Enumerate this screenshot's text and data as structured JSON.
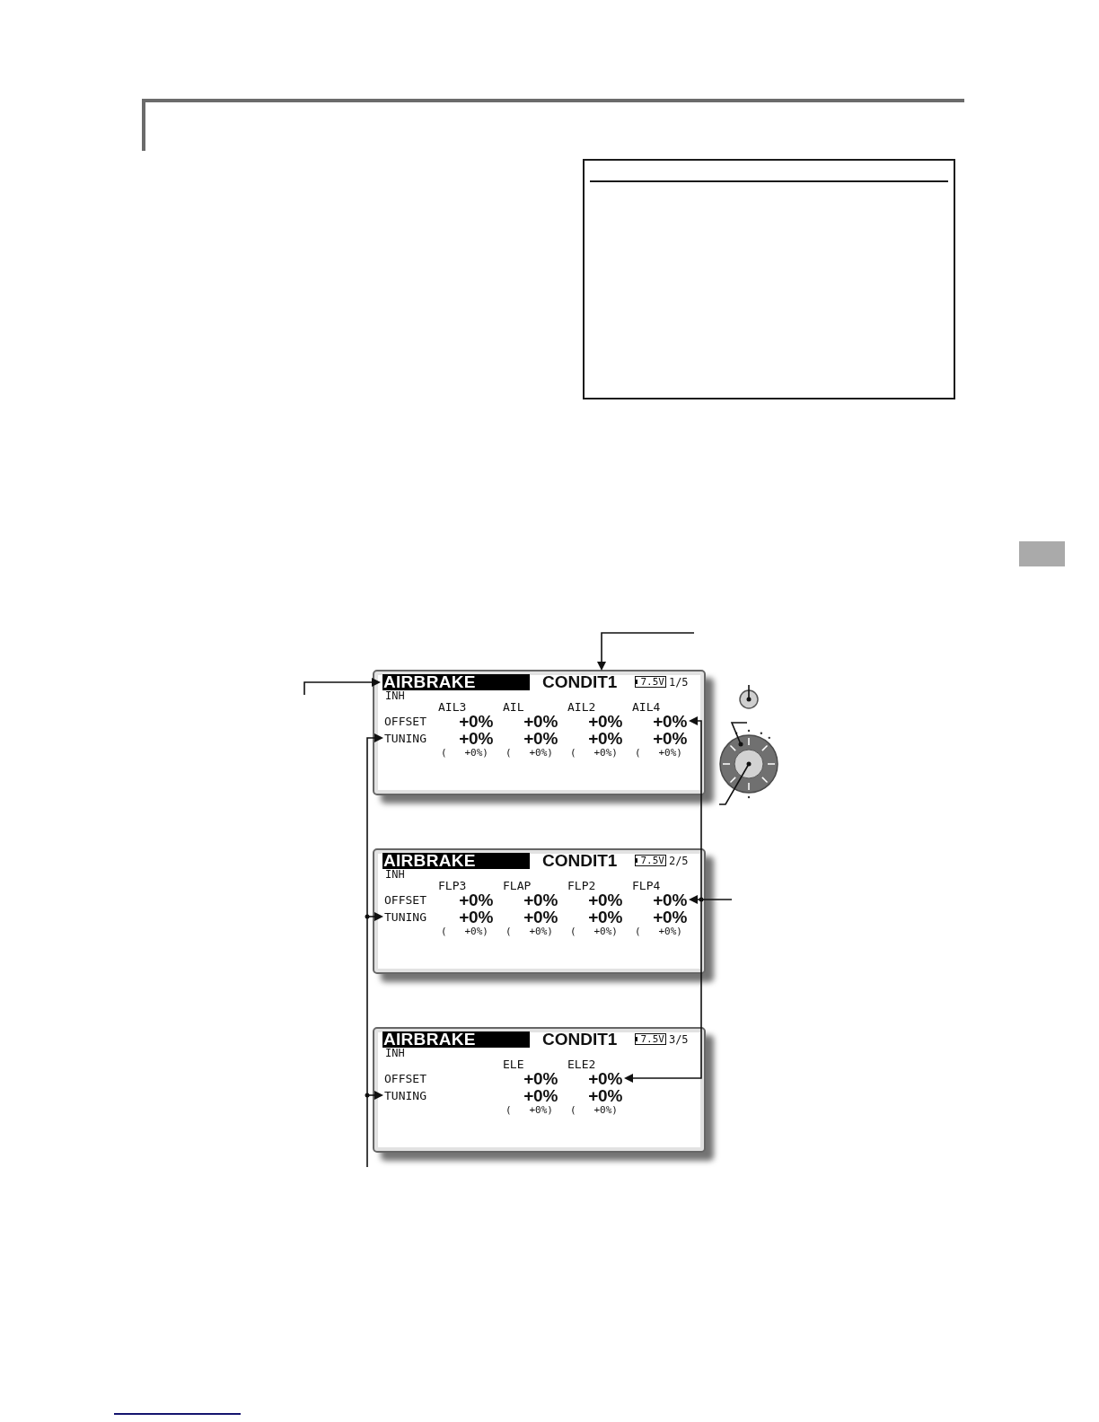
{
  "figure": {
    "screens": [
      {
        "title": "AIRBRAKE",
        "condition": "CONDIT1",
        "battery": "7.5V",
        "page": "1/5",
        "status": "INH",
        "offset_label": "OFFSET",
        "tuning_label": "TUNING",
        "channels": [
          {
            "name": "AIL3",
            "offset": "+0%",
            "tuning": "+0%",
            "rate_open": "(",
            "rate": "+0%)"
          },
          {
            "name": "AIL",
            "offset": "+0%",
            "tuning": "+0%",
            "rate_open": "(",
            "rate": "+0%)"
          },
          {
            "name": "AIL2",
            "offset": "+0%",
            "tuning": "+0%",
            "rate_open": "(",
            "rate": "+0%)"
          },
          {
            "name": "AIL4",
            "offset": "+0%",
            "tuning": "+0%",
            "rate_open": "(",
            "rate": "+0%)"
          }
        ]
      },
      {
        "title": "AIRBRAKE",
        "condition": "CONDIT1",
        "battery": "7.5V",
        "page": "2/5",
        "status": "INH",
        "offset_label": "OFFSET",
        "tuning_label": "TUNING",
        "channels": [
          {
            "name": "FLP3",
            "offset": "+0%",
            "tuning": "+0%",
            "rate_open": "(",
            "rate": "+0%)"
          },
          {
            "name": "FLAP",
            "offset": "+0%",
            "tuning": "+0%",
            "rate_open": "(",
            "rate": "+0%)"
          },
          {
            "name": "FLP2",
            "offset": "+0%",
            "tuning": "+0%",
            "rate_open": "(",
            "rate": "+0%)"
          },
          {
            "name": "FLP4",
            "offset": "+0%",
            "tuning": "+0%",
            "rate_open": "(",
            "rate": "+0%)"
          }
        ]
      },
      {
        "title": "AIRBRAKE",
        "condition": "CONDIT1",
        "battery": "7.5V",
        "page": "3/5",
        "status": "INH",
        "offset_label": "OFFSET",
        "tuning_label": "TUNING",
        "channels": [
          {
            "name": "ELE",
            "offset": "+0%",
            "tuning": "+0%",
            "rate_open": "(",
            "rate": "+0%)"
          },
          {
            "name": "ELE2",
            "offset": "+0%",
            "tuning": "+0%",
            "rate_open": "(",
            "rate": "+0%)"
          }
        ]
      }
    ]
  }
}
